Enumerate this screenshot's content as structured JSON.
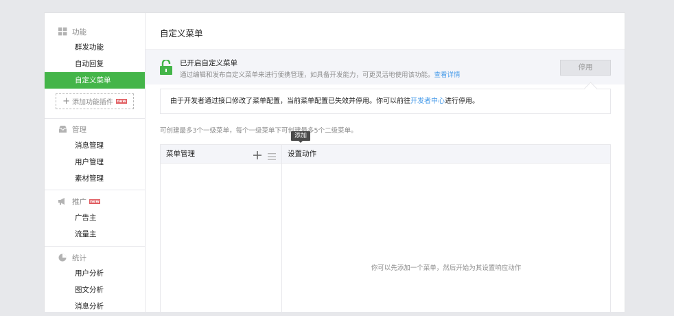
{
  "sidebar": {
    "sections": [
      {
        "title": "功能",
        "icon": "grid-icon",
        "items": [
          "群发功能",
          "自动回复",
          "自定义菜单"
        ],
        "active": "自定义菜单"
      },
      {
        "title": "管理",
        "icon": "inbox-icon",
        "items": [
          "消息管理",
          "用户管理",
          "素材管理"
        ]
      },
      {
        "title": "推广",
        "icon": "megaphone-icon",
        "badge": "new",
        "items": [
          "广告主",
          "流量主"
        ]
      },
      {
        "title": "统计",
        "icon": "pie-chart-icon",
        "items": [
          "用户分析",
          "图文分析",
          "消息分析"
        ]
      }
    ],
    "add_plugin_label": "添加功能插件",
    "new_badge": "new"
  },
  "main": {
    "title": "自定义菜单",
    "status": {
      "title": "已开启自定义菜单",
      "desc": "通过编辑和发布自定义菜单来进行便携管理，如具备开发能力，可更灵活地使用该功能。",
      "link": "查看详情",
      "button": "停用"
    },
    "notice": {
      "before": "由于开发者通过接口修改了菜单配置，当前菜单配置已失效并停用。你可以前往",
      "link": "开发者中心",
      "after": "进行停用。"
    },
    "tip": "可创建最多3个一级菜单，每个一级菜单下可创建最多5个二级菜单。",
    "tooltip": "添加",
    "table": {
      "left_header": "菜单管理",
      "right_header": "设置动作",
      "empty_hint": "你可以先添加一个菜单，然后开始为其设置响应动作"
    }
  },
  "colors": {
    "accent": "#44b549",
    "link": "#459ae9",
    "badge": "#e15f63",
    "background": "#e7e8eb"
  }
}
